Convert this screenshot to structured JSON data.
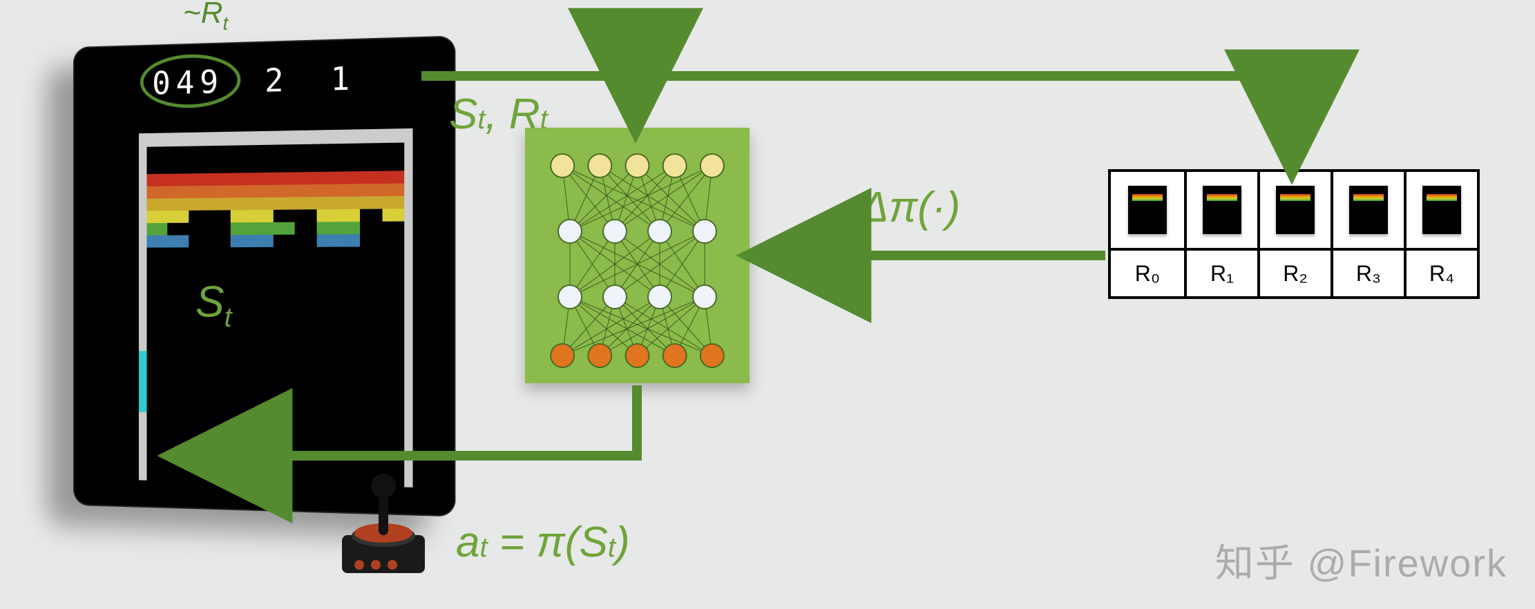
{
  "annotations": {
    "reward_approx": "~R",
    "reward_approx_sub": "t",
    "state": "S",
    "state_sub": "t",
    "transition": "S<sub>t</sub>,  R<sub>t</sub>",
    "transition_plain_pre": "S",
    "transition_plain_mid": ",  R",
    "transition_plain_sub": "t",
    "policy_update": "Δπ(·)",
    "action_pre": "a",
    "action_sub": "t",
    "action_post": " = π(S",
    "action_close": ")"
  },
  "game": {
    "score": "049",
    "lives": "2",
    "level": "1",
    "brick_colors": [
      "#c53020",
      "#d0682a",
      "#c9a82e",
      "#d7cf38",
      "#54a33a",
      "#3c7fb0"
    ]
  },
  "agent": {
    "layer_sizes": [
      5,
      4,
      4,
      5
    ],
    "layer_colors": [
      "#f2e39a",
      "#eef4fa",
      "#eef4fa",
      "#e0741f"
    ]
  },
  "replay_buffer": {
    "rewards": [
      "R₀",
      "R₁",
      "R₂",
      "R₃",
      "R₄"
    ]
  },
  "watermark": "知乎 @Firework"
}
